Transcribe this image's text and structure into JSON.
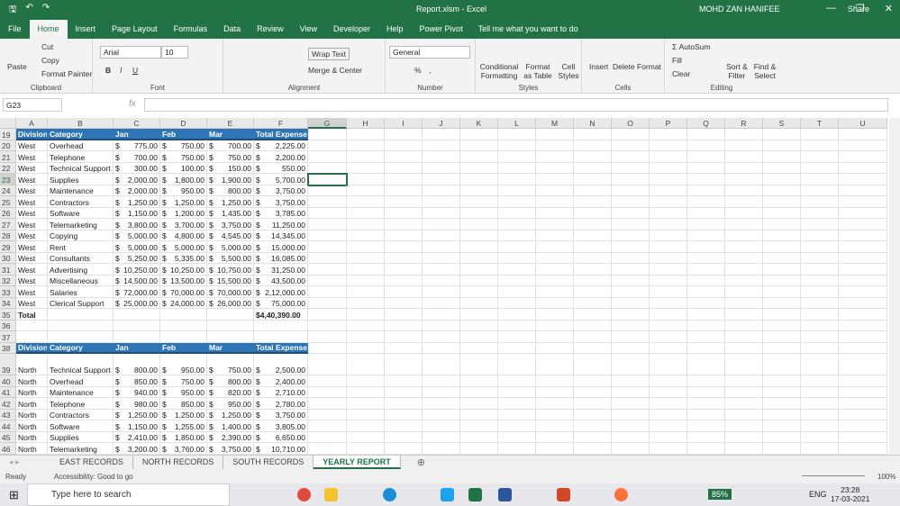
{
  "title": {
    "file": "Report.xlsm",
    "app": "Excel",
    "separator": "-",
    "user": "MOHD ZAN HANIFEE"
  },
  "ribbon_tabs": [
    "File",
    "Home",
    "Insert",
    "Page Layout",
    "Formulas",
    "Data",
    "Review",
    "View",
    "Developer",
    "Help",
    "Power Pivot"
  ],
  "tell_me": "Tell me what you want to do",
  "share": "Share",
  "clipboard": {
    "paste": "Paste",
    "cut": "Cut",
    "copy": "Copy",
    "format_painter": "Format Painter",
    "label": "Clipboard"
  },
  "font": {
    "name": "Arial",
    "size": "10",
    "label": "Font",
    "bold": "B",
    "italic": "I",
    "underline": "U"
  },
  "alignment": {
    "wrap": "Wrap Text",
    "merge": "Merge & Center",
    "label": "Alignment"
  },
  "number": {
    "format": "General",
    "label": "Number",
    "percent": "%",
    "comma": ","
  },
  "styles": {
    "conditional": "Conditional Formatting",
    "format_table": "Format as Table",
    "cell_styles": "Cell Styles",
    "label": "Styles"
  },
  "cells": {
    "insert": "Insert",
    "delete": "Delete",
    "format": "Format",
    "label": "Cells"
  },
  "editing": {
    "autosum": "AutoSum",
    "fill": "Fill",
    "clear": "Clear",
    "sort": "Sort & Filter",
    "find": "Find & Select",
    "label": "Editing"
  },
  "formula_bar": {
    "name_box": "G23",
    "fx": "fx",
    "value": ""
  },
  "columns": [
    "A",
    "B",
    "C",
    "D",
    "E",
    "F",
    "G",
    "H",
    "I",
    "J",
    "K",
    "L",
    "M",
    "N",
    "O",
    "P",
    "Q",
    "R",
    "S",
    "T",
    "U"
  ],
  "selected_cell": "G23",
  "headers": [
    "Division",
    "Category",
    "Jan",
    "Feb",
    "Mar",
    "Total Expense"
  ],
  "west_rows": [
    {
      "row": "20",
      "div": "West",
      "cat": "Overhead",
      "jan": "775.00",
      "feb": "750.00",
      "mar": "700.00",
      "tot": "2,225.00"
    },
    {
      "row": "21",
      "div": "West",
      "cat": "Telephone",
      "jan": "700.00",
      "feb": "750.00",
      "mar": "750.00",
      "tot": "2,200.00"
    },
    {
      "row": "22",
      "div": "West",
      "cat": "Technical Support",
      "jan": "300.00",
      "feb": "100.00",
      "mar": "150.00",
      "tot": "550.00"
    },
    {
      "row": "23",
      "div": "West",
      "cat": "Supplies",
      "jan": "2,000.00",
      "feb": "1,800.00",
      "mar": "1,900.00",
      "tot": "5,700.00"
    },
    {
      "row": "24",
      "div": "West",
      "cat": "Maintenance",
      "jan": "2,000.00",
      "feb": "950.00",
      "mar": "800.00",
      "tot": "3,750.00"
    },
    {
      "row": "25",
      "div": "West",
      "cat": "Contractors",
      "jan": "1,250.00",
      "feb": "1,250.00",
      "mar": "1,250.00",
      "tot": "3,750.00"
    },
    {
      "row": "26",
      "div": "West",
      "cat": "Software",
      "jan": "1,150.00",
      "feb": "1,200.00",
      "mar": "1,435.00",
      "tot": "3,785.00"
    },
    {
      "row": "27",
      "div": "West",
      "cat": "Telemarketing",
      "jan": "3,800.00",
      "feb": "3,700.00",
      "mar": "3,750.00",
      "tot": "11,250.00"
    },
    {
      "row": "28",
      "div": "West",
      "cat": "Copying",
      "jan": "5,000.00",
      "feb": "4,800.00",
      "mar": "4,545.00",
      "tot": "14,345.00"
    },
    {
      "row": "29",
      "div": "West",
      "cat": "Rent",
      "jan": "5,000.00",
      "feb": "5,000.00",
      "mar": "5,000.00",
      "tot": "15,000.00"
    },
    {
      "row": "30",
      "div": "West",
      "cat": "Consultants",
      "jan": "5,250.00",
      "feb": "5,335.00",
      "mar": "5,500.00",
      "tot": "16,085.00"
    },
    {
      "row": "31",
      "div": "West",
      "cat": "Advertising",
      "jan": "10,250.00",
      "feb": "10,250.00",
      "mar": "10,750.00",
      "tot": "31,250.00"
    },
    {
      "row": "32",
      "div": "West",
      "cat": "Miscellaneous",
      "jan": "14,500.00",
      "feb": "13,500.00",
      "mar": "15,500.00",
      "tot": "43,500.00"
    },
    {
      "row": "33",
      "div": "West",
      "cat": "Salaries",
      "jan": "72,000.00",
      "feb": "70,000.00",
      "mar": "70,000.00",
      "tot": "2,12,000.00"
    },
    {
      "row": "34",
      "div": "West",
      "cat": "Clerical Support",
      "jan": "25,000.00",
      "feb": "24,000.00",
      "mar": "26,000.00",
      "tot": "75,000.00"
    }
  ],
  "total": {
    "row": "35",
    "label": "Total",
    "value": "$4,40,390.00"
  },
  "header_rows": [
    "19",
    "38"
  ],
  "blank_rows": [
    "36",
    "37"
  ],
  "north_rows": [
    {
      "row": "39",
      "div": "North",
      "cat": "Technical Support",
      "jan": "800.00",
      "feb": "950.00",
      "mar": "750.00",
      "tot": "2,500.00"
    },
    {
      "row": "40",
      "div": "North",
      "cat": "Overhead",
      "jan": "850.00",
      "feb": "750.00",
      "mar": "800.00",
      "tot": "2,400.00"
    },
    {
      "row": "41",
      "div": "North",
      "cat": "Maintenance",
      "jan": "940.00",
      "feb": "950.00",
      "mar": "820.00",
      "tot": "2,710.00"
    },
    {
      "row": "42",
      "div": "North",
      "cat": "Telephone",
      "jan": "980.00",
      "feb": "850.00",
      "mar": "950.00",
      "tot": "2,780.00"
    },
    {
      "row": "43",
      "div": "North",
      "cat": "Contractors",
      "jan": "1,250.00",
      "feb": "1,250.00",
      "mar": "1,250.00",
      "tot": "3,750.00"
    },
    {
      "row": "44",
      "div": "North",
      "cat": "Software",
      "jan": "1,150.00",
      "feb": "1,255.00",
      "mar": "1,400.00",
      "tot": "3,805.00"
    },
    {
      "row": "45",
      "div": "North",
      "cat": "Supplies",
      "jan": "2,410.00",
      "feb": "1,850.00",
      "mar": "2,390.00",
      "tot": "6,650.00"
    },
    {
      "row": "46",
      "div": "North",
      "cat": "Telemarketing",
      "jan": "3,200.00",
      "feb": "3,760.00",
      "mar": "3,750.00",
      "tot": "10,710.00"
    }
  ],
  "currency": "$",
  "sheet_tabs": [
    "EAST RECORDS",
    "NORTH RECORDS",
    "SOUTH RECORDS",
    "YEARLY REPORT"
  ],
  "active_sheet": "YEARLY REPORT",
  "status": {
    "ready": "Ready",
    "accessibility": "Accessibility: Good to go",
    "zoom": "100%"
  },
  "taskbar": {
    "search": "Type here to search",
    "battery": "85%",
    "lang": "ENG",
    "time": "23:28",
    "date": "17-03-2021"
  },
  "colors": {
    "excel_green": "#217346",
    "header_blue": "#2e75b6"
  }
}
